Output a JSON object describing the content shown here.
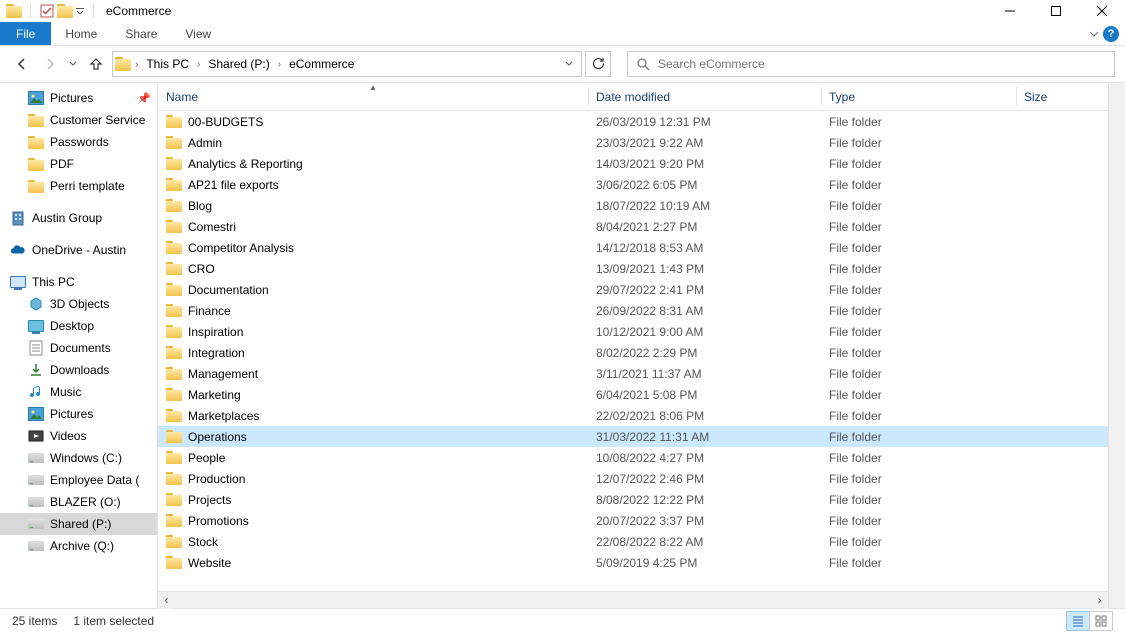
{
  "window": {
    "title": "eCommerce"
  },
  "ribbon": {
    "file": "File",
    "tabs": [
      "Home",
      "Share",
      "View"
    ]
  },
  "breadcrumb": [
    "This PC",
    "Shared (P:)",
    "eCommerce"
  ],
  "search": {
    "placeholder": "Search eCommerce"
  },
  "columns": {
    "name": "Name",
    "date": "Date modified",
    "type": "Type",
    "size": "Size"
  },
  "sidebar": {
    "quick": [
      {
        "label": "Pictures",
        "icon": "pictures",
        "pinned": true
      },
      {
        "label": "Customer Service",
        "icon": "folder"
      },
      {
        "label": "Passwords",
        "icon": "folder"
      },
      {
        "label": "PDF",
        "icon": "folder"
      },
      {
        "label": "Perri template",
        "icon": "folder"
      }
    ],
    "groups": [
      {
        "label": "Austin Group",
        "icon": "building"
      },
      {
        "label": "OneDrive - Austin",
        "icon": "onedrive"
      }
    ],
    "pc": {
      "label": "This PC"
    },
    "pcitems": [
      {
        "label": "3D Objects",
        "icon": "3d"
      },
      {
        "label": "Desktop",
        "icon": "desktop"
      },
      {
        "label": "Documents",
        "icon": "documents"
      },
      {
        "label": "Downloads",
        "icon": "downloads"
      },
      {
        "label": "Music",
        "icon": "music"
      },
      {
        "label": "Pictures",
        "icon": "pictures"
      },
      {
        "label": "Videos",
        "icon": "videos"
      },
      {
        "label": "Windows (C:)",
        "icon": "drive"
      },
      {
        "label": "Employee Data (",
        "icon": "drive"
      },
      {
        "label": "BLAZER (O:)",
        "icon": "drive"
      },
      {
        "label": "Shared (P:)",
        "icon": "drive",
        "selected": true
      },
      {
        "label": "Archive (Q:)",
        "icon": "drive"
      }
    ]
  },
  "rows": [
    {
      "name": "00-BUDGETS",
      "date": "26/03/2019 12:31 PM",
      "type": "File folder"
    },
    {
      "name": "Admin",
      "date": "23/03/2021 9:22 AM",
      "type": "File folder"
    },
    {
      "name": "Analytics & Reporting",
      "date": "14/03/2021 9:20 PM",
      "type": "File folder"
    },
    {
      "name": "AP21 file exports",
      "date": "3/06/2022 6:05 PM",
      "type": "File folder"
    },
    {
      "name": "Blog",
      "date": "18/07/2022 10:19 AM",
      "type": "File folder"
    },
    {
      "name": "Comestri",
      "date": "8/04/2021 2:27 PM",
      "type": "File folder"
    },
    {
      "name": "Competitor Analysis",
      "date": "14/12/2018 8:53 AM",
      "type": "File folder"
    },
    {
      "name": "CRO",
      "date": "13/09/2021 1:43 PM",
      "type": "File folder"
    },
    {
      "name": "Documentation",
      "date": "29/07/2022 2:41 PM",
      "type": "File folder"
    },
    {
      "name": "Finance",
      "date": "26/09/2022 8:31 AM",
      "type": "File folder"
    },
    {
      "name": "Inspiration",
      "date": "10/12/2021 9:00 AM",
      "type": "File folder"
    },
    {
      "name": "Integration",
      "date": "8/02/2022 2:29 PM",
      "type": "File folder"
    },
    {
      "name": "Management",
      "date": "3/11/2021 11:37 AM",
      "type": "File folder"
    },
    {
      "name": "Marketing",
      "date": "6/04/2021 5:08 PM",
      "type": "File folder"
    },
    {
      "name": "Marketplaces",
      "date": "22/02/2021 8:06 PM",
      "type": "File folder"
    },
    {
      "name": "Operations",
      "date": "31/03/2022 11:31 AM",
      "type": "File folder",
      "selected": true
    },
    {
      "name": "People",
      "date": "10/08/2022 4:27 PM",
      "type": "File folder"
    },
    {
      "name": "Production",
      "date": "12/07/2022 2:46 PM",
      "type": "File folder"
    },
    {
      "name": "Projects",
      "date": "8/08/2022 12:22 PM",
      "type": "File folder"
    },
    {
      "name": "Promotions",
      "date": "20/07/2022 3:37 PM",
      "type": "File folder"
    },
    {
      "name": "Stock",
      "date": "22/08/2022 8:22 AM",
      "type": "File folder"
    },
    {
      "name": "Website",
      "date": "5/09/2019 4:25 PM",
      "type": "File folder"
    }
  ],
  "status": {
    "count": "25 items",
    "selected": "1 item selected"
  }
}
